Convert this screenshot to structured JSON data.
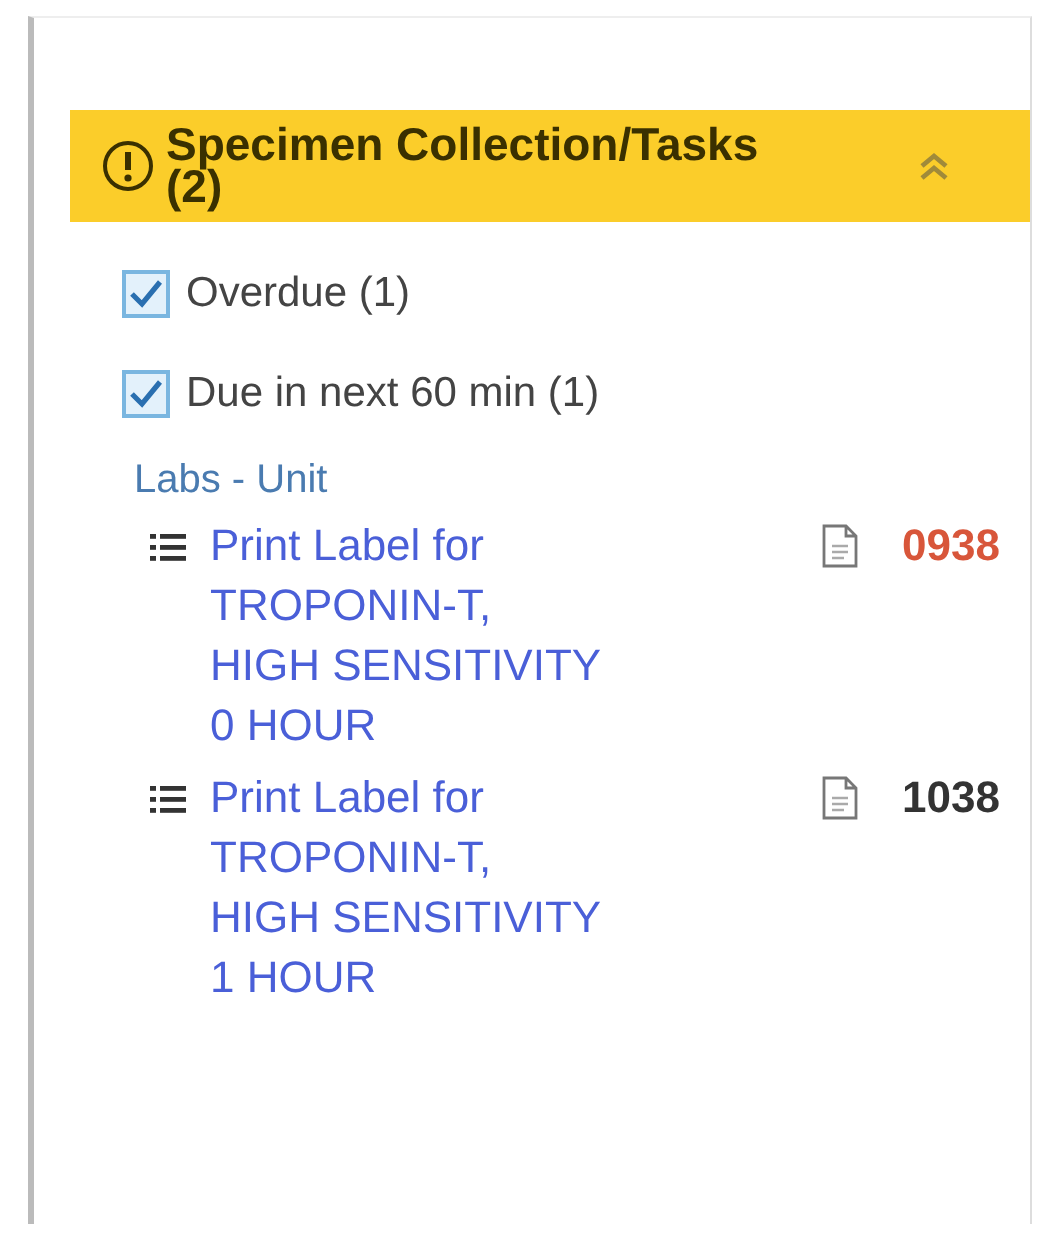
{
  "panel": {
    "title": "Specimen Collection/Tasks (2)",
    "expanded": true
  },
  "filters": [
    {
      "label": "Overdue (1)",
      "checked": true
    },
    {
      "label": "Due in next 60 min (1)",
      "checked": true
    }
  ],
  "group": "Labs - Unit",
  "tasks": [
    {
      "title": "Print Label for TROPONIN-T, HIGH SENSITIVITY 0 HOUR",
      "time": "0938",
      "overdue": true
    },
    {
      "title": "Print Label for TROPONIN-T, HIGH SENSITIVITY 1 HOUR",
      "time": "1038",
      "overdue": false
    }
  ]
}
